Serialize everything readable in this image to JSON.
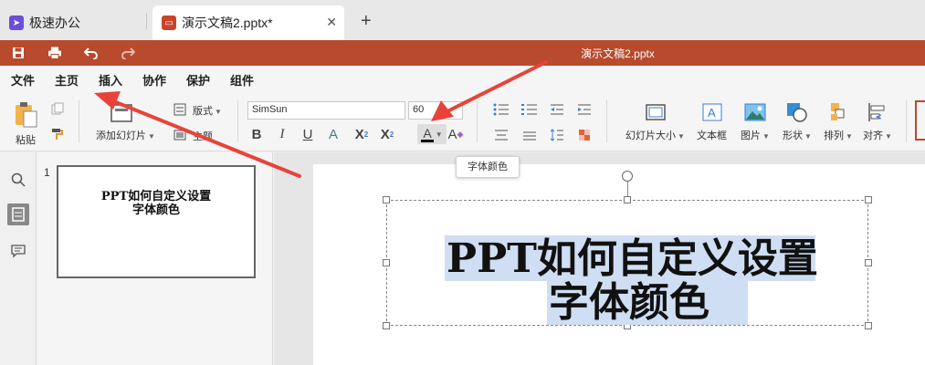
{
  "tabs": {
    "home_label": "极速办公",
    "doc_label": "演示文稿2.pptx*",
    "close_glyph": "✕",
    "new_tab_glyph": "+"
  },
  "titlebar": {
    "doc_title": "演示文稿2.pptx",
    "color": "#b84a2d"
  },
  "menu": {
    "items": [
      "文件",
      "主页",
      "插入",
      "协作",
      "保护",
      "组件"
    ],
    "active": "主页"
  },
  "ribbon": {
    "paste_label": "粘贴",
    "add_slide_label": "添加幻灯片",
    "layout_label": "版式",
    "theme_label": "主题",
    "font_name": "SimSun",
    "font_size": "60",
    "slide_size_label": "幻灯片大小",
    "textbox_label": "文本框",
    "image_label": "图片",
    "shape_label": "形状",
    "arrange_label": "排列",
    "align_label": "对齐",
    "bold": "B",
    "italic": "I",
    "underline": "U",
    "strike": "A",
    "superscript": "X",
    "subscript": "X",
    "sup_mark": "2",
    "sub_mark": "2",
    "font_color": "A",
    "highlight": "A",
    "font_color_value": "#000000"
  },
  "tooltip": {
    "text": "字体颜色"
  },
  "thumbnails": [
    {
      "number": "1",
      "line1": "PPT如何自定义设置",
      "line2": "字体颜色"
    }
  ],
  "slide": {
    "line1": "PPT如何自定义设置",
    "line2": "字体颜色",
    "selection_color": "#cfdef3"
  },
  "annotations": {
    "arrow_color": "#e8433b"
  }
}
